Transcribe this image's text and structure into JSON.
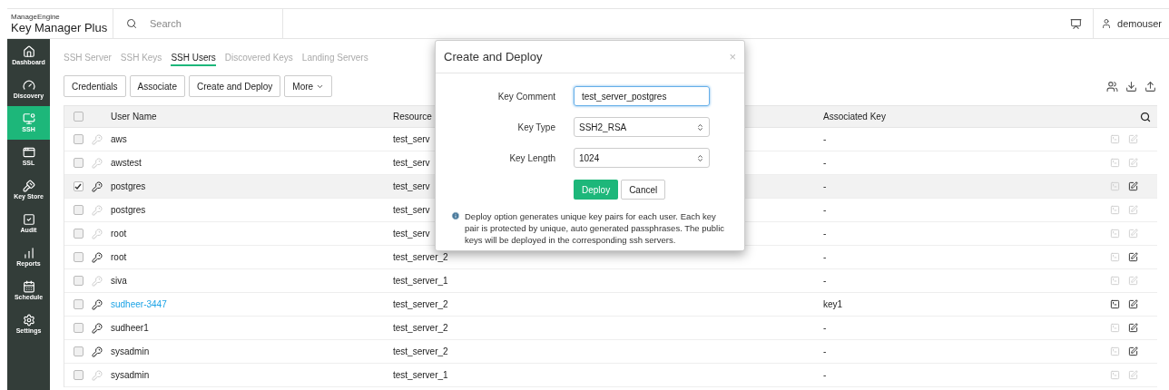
{
  "app": {
    "brand_top": "ManageEngine",
    "brand": "Key Manager Plus"
  },
  "search": {
    "placeholder": "Search"
  },
  "user": {
    "name": "demouser"
  },
  "sidebar": {
    "items": [
      {
        "label": "Dashboard",
        "selected": false
      },
      {
        "label": "Discovery",
        "selected": false
      },
      {
        "label": "SSH",
        "selected": true
      },
      {
        "label": "SSL",
        "selected": false
      },
      {
        "label": "Key Store",
        "selected": false
      },
      {
        "label": "Audit",
        "selected": false
      },
      {
        "label": "Reports",
        "selected": false
      },
      {
        "label": "Schedule",
        "selected": false
      },
      {
        "label": "Settings",
        "selected": false
      }
    ]
  },
  "tabs": [
    {
      "label": "SSH Server",
      "selected": false
    },
    {
      "label": "SSH Keys",
      "selected": false
    },
    {
      "label": "SSH Users",
      "selected": true
    },
    {
      "label": "Discovered Keys",
      "selected": false
    },
    {
      "label": "Landing Servers",
      "selected": false
    }
  ],
  "toolbar": {
    "buttons": [
      "Credentials",
      "Associate",
      "Create and Deploy"
    ],
    "more": "More"
  },
  "table": {
    "columns": [
      "User Name",
      "Resource",
      "Associated Key"
    ],
    "header_checked": false,
    "rows": [
      {
        "checked": false,
        "selected": false,
        "key_active": false,
        "user": "aws",
        "link": false,
        "resource": "test_serv",
        "associated_key": "-",
        "terminal_enabled": false,
        "edit_enabled": false
      },
      {
        "checked": false,
        "selected": false,
        "key_active": false,
        "user": "awstest",
        "link": false,
        "resource": "test_serv",
        "associated_key": "-",
        "terminal_enabled": false,
        "edit_enabled": false
      },
      {
        "checked": true,
        "selected": true,
        "key_active": true,
        "user": "postgres",
        "link": false,
        "resource": "test_serv",
        "associated_key": "-",
        "terminal_enabled": false,
        "edit_enabled": true
      },
      {
        "checked": false,
        "selected": false,
        "key_active": false,
        "user": "postgres",
        "link": false,
        "resource": "test_serv",
        "associated_key": "-",
        "terminal_enabled": false,
        "edit_enabled": false
      },
      {
        "checked": false,
        "selected": false,
        "key_active": false,
        "user": "root",
        "link": false,
        "resource": "test_serv",
        "associated_key": "-",
        "terminal_enabled": false,
        "edit_enabled": false
      },
      {
        "checked": false,
        "selected": false,
        "key_active": true,
        "user": "root",
        "link": false,
        "resource": "test_server_2",
        "associated_key": "-",
        "terminal_enabled": false,
        "edit_enabled": true
      },
      {
        "checked": false,
        "selected": false,
        "key_active": false,
        "user": "siva",
        "link": false,
        "resource": "test_server_1",
        "associated_key": "-",
        "terminal_enabled": false,
        "edit_enabled": false
      },
      {
        "checked": false,
        "selected": false,
        "key_active": true,
        "user": "sudheer-3447",
        "link": true,
        "resource": "test_server_2",
        "associated_key": "key1",
        "terminal_enabled": true,
        "edit_enabled": true
      },
      {
        "checked": false,
        "selected": false,
        "key_active": true,
        "user": "sudheer1",
        "link": false,
        "resource": "test_server_2",
        "associated_key": "-",
        "terminal_enabled": false,
        "edit_enabled": true
      },
      {
        "checked": false,
        "selected": false,
        "key_active": true,
        "user": "sysadmin",
        "link": false,
        "resource": "test_server_2",
        "associated_key": "-",
        "terminal_enabled": false,
        "edit_enabled": true
      },
      {
        "checked": false,
        "selected": false,
        "key_active": false,
        "user": "sysadmin",
        "link": false,
        "resource": "test_server_1",
        "associated_key": "-",
        "terminal_enabled": false,
        "edit_enabled": false
      }
    ]
  },
  "dialog": {
    "title": "Create and Deploy",
    "close": "×",
    "fields": [
      {
        "kind": "input",
        "label": "Key Comment",
        "value": "test_server_postgres",
        "focused": true
      },
      {
        "kind": "select",
        "label": "Key Type",
        "value": "SSH2_RSA",
        "focused": false
      },
      {
        "kind": "select",
        "label": "Key Length",
        "value": "1024",
        "focused": false
      }
    ],
    "primary": "Deploy",
    "secondary": "Cancel",
    "note": "Deploy option generates unique key pairs for each user. Each key pair is protected by unique, auto generated passphrases. The public keys will be deployed in the corresponding ssh servers."
  }
}
